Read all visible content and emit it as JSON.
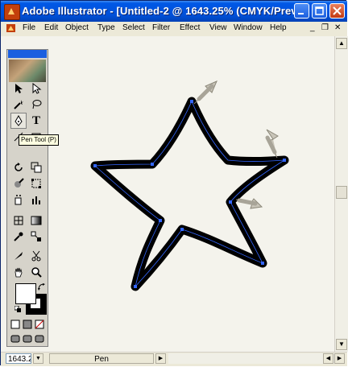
{
  "window": {
    "title": "Adobe Illustrator - [Untitled-2 @ 1643.25% (CMYK/Previe",
    "buttons": {
      "minimize": "_",
      "maximize": "□",
      "close": "✕"
    }
  },
  "menubar": {
    "items": [
      "File",
      "Edit",
      "Object",
      "Type",
      "Select",
      "Filter",
      "Effect",
      "View",
      "Window",
      "Help"
    ],
    "mdi_minimize": "_",
    "mdi_restore": "❐",
    "mdi_close": "✕"
  },
  "toolbox": {
    "tooltip": "Pen Tool (P)",
    "active_tool": "pen-tool",
    "text_tool_label": "T"
  },
  "statusbar": {
    "zoom": "1643.2",
    "status": "Pen"
  },
  "colors": {
    "titlebar": "#0050d8",
    "canvas": "#f4f3ec",
    "anchor": "#3366ff",
    "stroke": "#000000"
  }
}
